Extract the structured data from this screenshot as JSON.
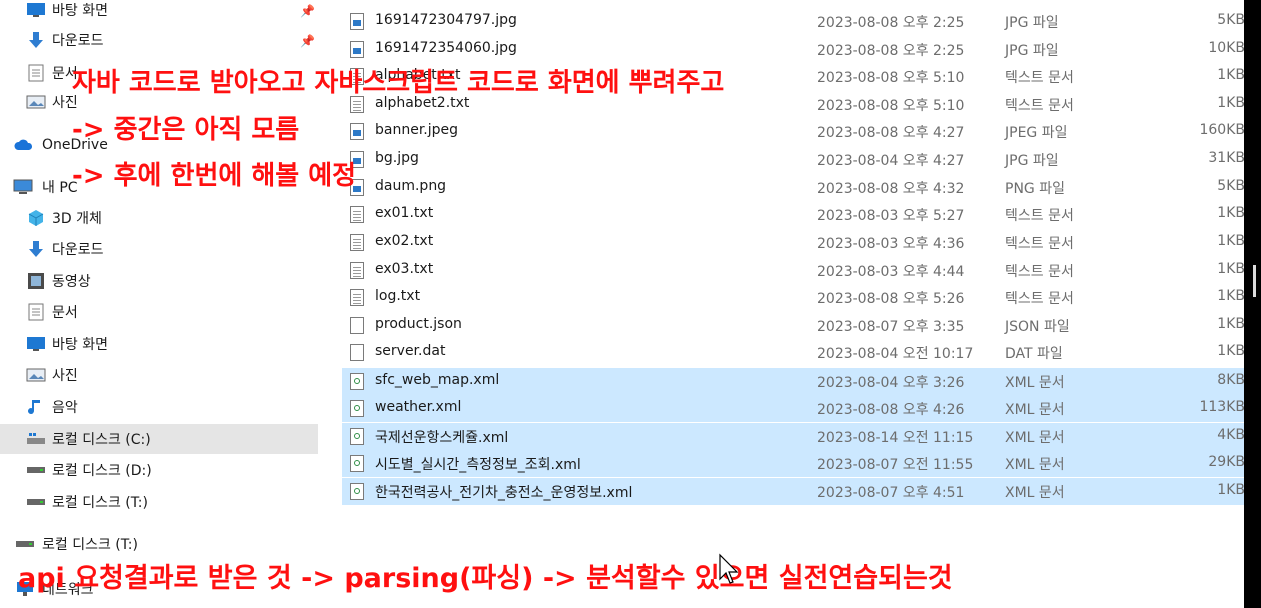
{
  "sidebar": {
    "items": [
      {
        "label": "바탕 화면",
        "icon": "desktop-icon",
        "pinned": true
      },
      {
        "label": "다운로드",
        "icon": "download-arrow-icon",
        "pinned": true
      },
      {
        "label": "문서",
        "icon": "document-icon",
        "pinned": true
      },
      {
        "label": "사진",
        "icon": "pictures-icon",
        "pinned": true
      },
      {
        "label": "OneDrive",
        "icon": "cloud-icon"
      },
      {
        "label": "내 PC",
        "icon": "computer-icon"
      },
      {
        "label": "3D 개체",
        "icon": "cube-3d-icon"
      },
      {
        "label": "다운로드",
        "icon": "download-arrow-icon"
      },
      {
        "label": "동영상",
        "icon": "video-icon"
      },
      {
        "label": "문서",
        "icon": "document-icon"
      },
      {
        "label": "바탕 화면",
        "icon": "desktop-icon"
      },
      {
        "label": "사진",
        "icon": "pictures-icon"
      },
      {
        "label": "음악",
        "icon": "music-note-icon"
      },
      {
        "label": "로컬 디스크 (C:)",
        "icon": "windows-drive-icon",
        "selected": true
      },
      {
        "label": "로컬 디스크 (D:)",
        "icon": "drive-icon"
      },
      {
        "label": "로컬 디스크 (T:)",
        "icon": "drive-icon"
      },
      {
        "label": "로컬 디스크 (T:)",
        "icon": "drive-icon"
      },
      {
        "label": "네트워크",
        "icon": "network-icon"
      }
    ]
  },
  "files": [
    {
      "name": "1691472304797.jpg",
      "date": "2023-08-08 오후 2:25",
      "type": "JPG 파일",
      "size": "5KB",
      "icon": "image-file-icon"
    },
    {
      "name": "1691472354060.jpg",
      "date": "2023-08-08 오후 2:25",
      "type": "JPG 파일",
      "size": "10KB",
      "icon": "image-file-icon"
    },
    {
      "name": "alphabet.txt",
      "date": "2023-08-08 오후 5:10",
      "type": "텍스트 문서",
      "size": "1KB",
      "icon": "text-file-icon"
    },
    {
      "name": "alphabet2.txt",
      "date": "2023-08-08 오후 5:10",
      "type": "텍스트 문서",
      "size": "1KB",
      "icon": "text-file-icon"
    },
    {
      "name": "banner.jpeg",
      "date": "2023-08-08 오후 4:27",
      "type": "JPEG 파일",
      "size": "160KB",
      "icon": "image-file-icon"
    },
    {
      "name": "bg.jpg",
      "date": "2023-08-04 오후 4:27",
      "type": "JPG 파일",
      "size": "31KB",
      "icon": "image-file-icon"
    },
    {
      "name": "daum.png",
      "date": "2023-08-08 오후 4:32",
      "type": "PNG 파일",
      "size": "5KB",
      "icon": "image-file-icon"
    },
    {
      "name": "ex01.txt",
      "date": "2023-08-03 오후 5:27",
      "type": "텍스트 문서",
      "size": "1KB",
      "icon": "text-file-icon"
    },
    {
      "name": "ex02.txt",
      "date": "2023-08-03 오후 4:36",
      "type": "텍스트 문서",
      "size": "1KB",
      "icon": "text-file-icon"
    },
    {
      "name": "ex03.txt",
      "date": "2023-08-03 오후 4:44",
      "type": "텍스트 문서",
      "size": "1KB",
      "icon": "text-file-icon"
    },
    {
      "name": "log.txt",
      "date": "2023-08-08 오후 5:26",
      "type": "텍스트 문서",
      "size": "1KB",
      "icon": "text-file-icon"
    },
    {
      "name": "product.json",
      "date": "2023-08-07 오후 3:35",
      "type": "JSON 파일",
      "size": "1KB",
      "icon": "blank-file-icon"
    },
    {
      "name": "server.dat",
      "date": "2023-08-04 오전 10:17",
      "type": "DAT 파일",
      "size": "1KB",
      "icon": "blank-file-icon"
    },
    {
      "name": "sfc_web_map.xml",
      "date": "2023-08-04 오후 3:26",
      "type": "XML 문서",
      "size": "8KB",
      "icon": "xml-file-icon",
      "selected": true
    },
    {
      "name": "weather.xml",
      "date": "2023-08-08 오후 4:26",
      "type": "XML 문서",
      "size": "113KB",
      "icon": "xml-file-icon",
      "selected": true
    },
    {
      "name": "국제선운항스케쥴.xml",
      "date": "2023-08-14 오전 11:15",
      "type": "XML 문서",
      "size": "4KB",
      "icon": "xml-file-icon",
      "selected": true
    },
    {
      "name": "시도별_실시간_측정정보_조회.xml",
      "date": "2023-08-07 오전 11:55",
      "type": "XML 문서",
      "size": "29KB",
      "icon": "xml-file-icon",
      "selected": true
    },
    {
      "name": "한국전력공사_전기차_충전소_운영정보.xml",
      "date": "2023-08-07 오후 4:51",
      "type": "XML 문서",
      "size": "1KB",
      "icon": "xml-file-icon",
      "selected": true
    }
  ],
  "annotations": [
    "자바 코드로 받아오고 자바스크립트 코드로 화면에 뿌려주고",
    "-> 중간은 아직 모름",
    "-> 후에 한번에 해볼 예정",
    "api 요청결과로 받은 것 -> parsing(파싱) -> 분석할수 있으면 실전연습되는것"
  ],
  "colors": {
    "annotation": "#ff1010",
    "selection": "#cce8ff",
    "nav_selected": "#e5e5e5"
  }
}
